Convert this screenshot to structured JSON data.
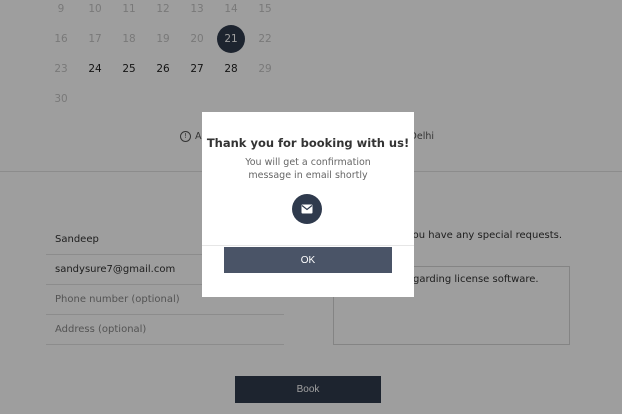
{
  "calendar": {
    "rows": [
      [
        {
          "d": "9",
          "s": "disabled"
        },
        {
          "d": "10",
          "s": "disabled"
        },
        {
          "d": "11",
          "s": "disabled"
        },
        {
          "d": "12",
          "s": "disabled"
        },
        {
          "d": "13",
          "s": "disabled"
        },
        {
          "d": "14",
          "s": "disabled"
        },
        {
          "d": "15",
          "s": "disabled"
        }
      ],
      [
        {
          "d": "16",
          "s": "disabled"
        },
        {
          "d": "17",
          "s": "disabled"
        },
        {
          "d": "18",
          "s": "disabled"
        },
        {
          "d": "19",
          "s": "disabled"
        },
        {
          "d": "20",
          "s": "disabled"
        },
        {
          "d": "21",
          "s": "selected"
        },
        {
          "d": "22",
          "s": "disabled"
        }
      ],
      [
        {
          "d": "23",
          "s": "disabled"
        },
        {
          "d": "24",
          "s": "active"
        },
        {
          "d": "25",
          "s": "active"
        },
        {
          "d": "26",
          "s": "active"
        },
        {
          "d": "27",
          "s": "active"
        },
        {
          "d": "28",
          "s": "active"
        },
        {
          "d": "29",
          "s": "disabled"
        }
      ],
      [
        {
          "d": "30",
          "s": "disabled"
        }
      ]
    ]
  },
  "timezone": {
    "left_text": "A",
    "right_text": "Delhi"
  },
  "form": {
    "name": "Sandeep",
    "email": "sandysure7@gmail.com",
    "phone_placeholder": "Phone number (optional)",
    "address_placeholder": "Address (optional)",
    "special_requests_label": "f you have any special requests.",
    "message_text": "garding license software.",
    "book_label": "Book"
  },
  "modal": {
    "title": "Thank you for booking with us!",
    "message": "You will get a confirmation message in email shortly",
    "ok_label": "OK"
  },
  "colors": {
    "primary": "#2f3a4d",
    "ok_button": "#4a5467"
  }
}
